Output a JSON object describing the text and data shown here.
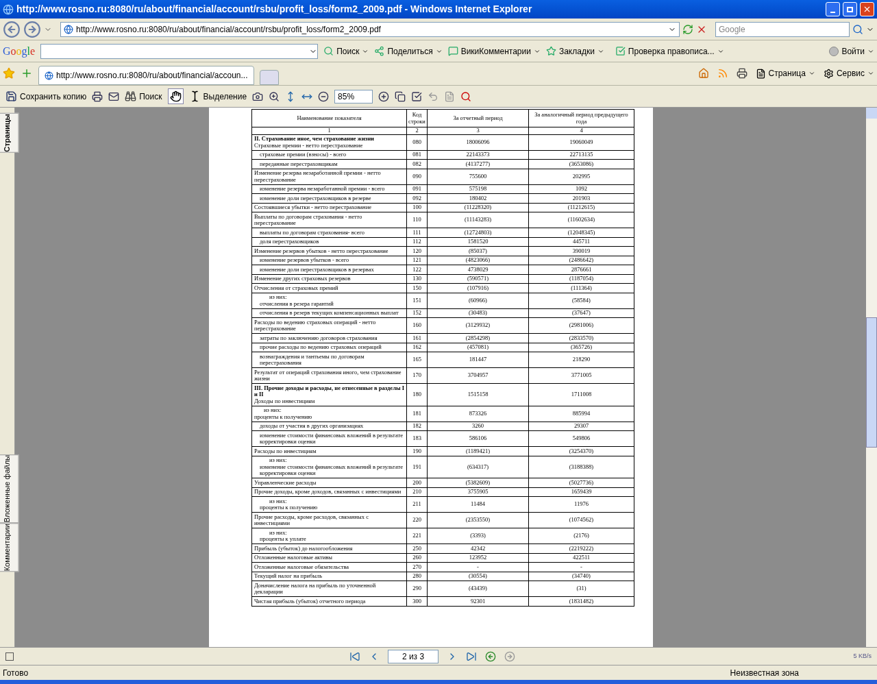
{
  "window": {
    "title": "http://www.rosno.ru:8080/ru/about/financial/account/rsbu/profit_loss/form2_2009.pdf - Windows Internet Explorer"
  },
  "address_bar": {
    "value": "http://www.rosno.ru:8080/ru/about/financial/account/rsbu/profit_loss/form2_2009.pdf",
    "search_placeholder": "Google"
  },
  "google_toolbar": {
    "logo": "Google",
    "items": [
      "Поиск",
      "Поделиться",
      "ВикиКомментарии",
      "Закладки",
      "Проверка правописа...",
      "Войти"
    ]
  },
  "tabs": [
    {
      "label": "http://www.rosno.ru:8080/ru/about/financial/accoun...",
      "selected": true
    }
  ],
  "command_bar": [
    "Страница",
    "Сервис"
  ],
  "pdf_toolbar": {
    "save": "Сохранить копию",
    "search": "Поиск",
    "select": "Выделение",
    "zoom": "85%"
  },
  "side_tabs": [
    "Страницы",
    "Вложенные файлы",
    "Комментарии"
  ],
  "table": {
    "columns": [
      "Наименование показателя",
      "Код строки",
      "За отчетный период",
      "За аналогичный период предыдущего года"
    ],
    "column_numbers": [
      "1",
      "2",
      "3",
      "4"
    ],
    "rows": [
      {
        "kind": "main",
        "heading": "II. Страхование иное, чем страхование жизни",
        "name": "Страховые премии - нетто перестрахование",
        "code": "080",
        "current": "18006096",
        "previous": "19060049"
      },
      {
        "kind": "sub",
        "name": "страховые премии (взносы) - всего",
        "code": "081",
        "current": "22143373",
        "previous": "22713135"
      },
      {
        "kind": "sub",
        "name": "переданные перестраховщикам",
        "code": "082",
        "current": "(4137277)",
        "previous": "(3653086)"
      },
      {
        "kind": "main",
        "name": "Изменение резерва незаработанной премии - нетто перестрахование",
        "code": "090",
        "current": "755600",
        "previous": "202995"
      },
      {
        "kind": "sub",
        "name": "изменение резерва незаработанной премии - всего",
        "code": "091",
        "current": "575198",
        "previous": "1092"
      },
      {
        "kind": "sub",
        "name": "изменение доли перестраховщиков в резерве",
        "code": "092",
        "current": "180402",
        "previous": "201903"
      },
      {
        "kind": "main",
        "name": "Состоявшиеся убытки - нетто перестрахование",
        "code": "100",
        "current": "(11228320)",
        "previous": "(11212615)"
      },
      {
        "kind": "main",
        "name": "Выплаты по договорам страхования - нетто перестрахование",
        "code": "110",
        "current": "(11143283)",
        "previous": "(11602634)"
      },
      {
        "kind": "sub",
        "name": "выплаты по договорам страхования- всего",
        "code": "111",
        "current": "(12724803)",
        "previous": "(12048345)"
      },
      {
        "kind": "sub",
        "name": "доля перестраховщиков",
        "code": "112",
        "current": "1581520",
        "previous": "445711"
      },
      {
        "kind": "main",
        "name": "Изменение резервов убытков - нетто перестрахование",
        "code": "120",
        "current": "(85037)",
        "previous": "390019"
      },
      {
        "kind": "sub",
        "name": "изменение резервов убытков - всего",
        "code": "121",
        "current": "(4823066)",
        "previous": "(2486642)"
      },
      {
        "kind": "sub",
        "name": "изменение доли перестраховщиков в резервах",
        "code": "122",
        "current": "4738029",
        "previous": "2876661"
      },
      {
        "kind": "main",
        "name": "Изменение других страховых резервов",
        "code": "130",
        "current": "(590571)",
        "previous": "(1187054)"
      },
      {
        "kind": "main",
        "name": "Отчисления от страховых премий",
        "code": "150",
        "current": "(107916)",
        "previous": "(111364)"
      },
      {
        "kind": "sub",
        "note": "из них:",
        "name": "отчисления в резера гарантий",
        "code": "151",
        "current": "(60966)",
        "previous": "(58584)"
      },
      {
        "kind": "sub",
        "name": "отчисления в резерв текущих компенсационных выплат",
        "code": "152",
        "current": "(30483)",
        "previous": "(37647)"
      },
      {
        "kind": "main",
        "name": "Расходы по ведению страховых операций - нетто перестрахование",
        "code": "160",
        "current": "(3129932)",
        "previous": "(2981006)"
      },
      {
        "kind": "sub",
        "name": "затраты по заключению договоров страхования",
        "code": "161",
        "current": "(2854298)",
        "previous": "(2833570)"
      },
      {
        "kind": "sub",
        "name": "прочие расходы по ведению страховых операций",
        "code": "162",
        "current": "(457081)",
        "previous": "(365726)"
      },
      {
        "kind": "sub",
        "name": "вознаграждения и тантьемы по договорам перестрахования",
        "code": "165",
        "current": "181447",
        "previous": "218290"
      },
      {
        "kind": "main",
        "name": "Результат от операций страхования иного, чем страхование жизни",
        "code": "170",
        "current": "3704957",
        "previous": "3771005"
      },
      {
        "kind": "main",
        "heading": "III. Прочие доходы и расходы, не отнесенные в разделы I и II",
        "name": "Доходы по инвестициям",
        "code": "180",
        "current": "1515158",
        "previous": "1711008"
      },
      {
        "kind": "main",
        "note": "из них:",
        "name": "проценты к получению",
        "code": "181",
        "current": "873326",
        "previous": "885994"
      },
      {
        "kind": "sub",
        "name": "доходы от участия в других организациях",
        "code": "182",
        "current": "3260",
        "previous": "29307"
      },
      {
        "kind": "sub",
        "name": "изменение стоимости финансовых вложений в результате корректировки оценки",
        "code": "183",
        "current": "586106",
        "previous": "549806"
      },
      {
        "kind": "main",
        "name": "Расходы по инвестициям",
        "code": "190",
        "current": "(1189421)",
        "previous": "(3254370)"
      },
      {
        "kind": "sub",
        "note": "из них:",
        "name": "изменение стоимости финансовых вложений в результате корректировки оценки",
        "code": "191",
        "current": "(634317)",
        "previous": "(3188388)"
      },
      {
        "kind": "main",
        "name": "Управленческие расходы",
        "code": "200",
        "current": "(5382609)",
        "previous": "(5027736)"
      },
      {
        "kind": "main",
        "name": "Прочие доходы, кроме доходов, связанных с инвестициями",
        "code": "210",
        "current": "3755905",
        "previous": "1659439"
      },
      {
        "kind": "sub",
        "note": "из них:",
        "name": "проценты к получению",
        "code": "211",
        "current": "11484",
        "previous": "11976"
      },
      {
        "kind": "main",
        "name": "Прочие расходы, кроме расходов, связанных с инвестициями",
        "code": "220",
        "current": "(2353550)",
        "previous": "(1074562)"
      },
      {
        "kind": "sub",
        "note": "из них:",
        "name": "проценты к уплате",
        "code": "221",
        "current": "(3393)",
        "previous": "(2176)"
      },
      {
        "kind": "main",
        "name": "Прибыль (убыток) до налогообложения",
        "code": "250",
        "current": "42342",
        "previous": "(2219222)"
      },
      {
        "kind": "main",
        "name": "Отложенные налоговые активы",
        "code": "260",
        "current": "123952",
        "previous": "422511"
      },
      {
        "kind": "main",
        "name": "Отложенные налоговые обязательства",
        "code": "270",
        "current": "-",
        "previous": "-"
      },
      {
        "kind": "main",
        "name": "Текущий налог на прибыль",
        "code": "280",
        "current": "(30554)",
        "previous": "(34740)"
      },
      {
        "kind": "main",
        "name": "Доначисление налога на прибыль по уточненной декларации",
        "code": "290",
        "current": "(43439)",
        "previous": "(31)"
      },
      {
        "kind": "main",
        "name": "Чистая прибыль (убыток) отчетного периода",
        "code": "300",
        "current": "92301",
        "previous": "(1831482)"
      }
    ]
  },
  "pager": {
    "page": "2 из 3"
  },
  "status_bar": {
    "status": "Готово",
    "zone": "Неизвестная зона",
    "speed": "5 KB/s"
  }
}
